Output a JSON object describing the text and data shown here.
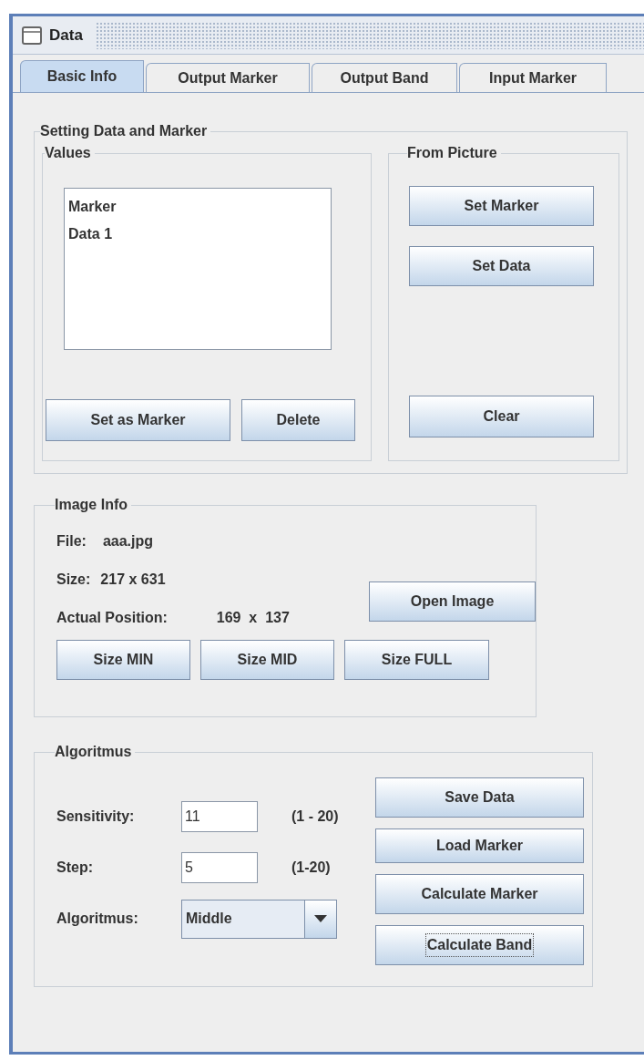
{
  "window": {
    "title": "Data"
  },
  "tabs": [
    {
      "label": "Basic Info",
      "selected": true
    },
    {
      "label": "Output Marker",
      "selected": false
    },
    {
      "label": "Output Band",
      "selected": false
    },
    {
      "label": "Input Marker",
      "selected": false
    }
  ],
  "setting_group": {
    "title": "Setting Data and Marker",
    "values": {
      "title": "Values",
      "list": [
        {
          "label": "Marker",
          "selected": false
        },
        {
          "label": "Data 1",
          "selected": false
        }
      ],
      "buttons": [
        "Set as Marker",
        "Delete"
      ]
    },
    "from_picture": {
      "title": "From Picture",
      "buttons": [
        "Set Marker",
        "Set Data"
      ],
      "bottom_button": "Clear"
    }
  },
  "image_info": {
    "title": "Image Info",
    "file_label": "File:",
    "file_value": "aaa.jpg",
    "size_label": "Size:",
    "size_value": "217 x 631",
    "position_label": "Actual Position:",
    "position_value": "169  x  137",
    "open_button": "Open Image",
    "size_buttons": [
      "Size MIN",
      "Size MID",
      "Size FULL"
    ]
  },
  "algorithm": {
    "title": "Algoritmus",
    "rows": [
      {
        "kind": "field",
        "label": "Sensitivity:",
        "value": "11",
        "range": "(1 - 20)"
      },
      {
        "kind": "field",
        "label": "Step:",
        "value": "5",
        "range": "(1-20)"
      },
      {
        "kind": "combo",
        "label": "Algoritmus:",
        "value": "Middle"
      }
    ],
    "buttons": [
      {
        "label": "Save Data",
        "focused": false
      },
      {
        "label": "Load Marker",
        "focused": false
      },
      {
        "label": "Calculate Marker",
        "focused": false
      },
      {
        "label": "Calculate Band",
        "focused": true
      }
    ]
  }
}
